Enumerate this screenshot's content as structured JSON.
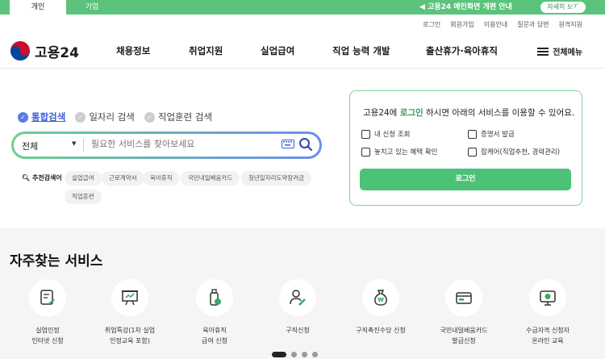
{
  "topbar": {
    "tabs": [
      "개인",
      "기업"
    ],
    "notice": "고용24 메인화면 개편 안내",
    "notice_button": "자세히 보기",
    "pause_icon": "pause-icon"
  },
  "util_links": [
    "로그인",
    "회원가입",
    "이용안내",
    "질문과 답변",
    "원격지원"
  ],
  "logo": {
    "text": "고용24"
  },
  "gnb": [
    "채용정보",
    "취업지원",
    "실업급여",
    "직업 능력 개발",
    "출산휴가·육아휴직"
  ],
  "menu_all": "전체메뉴",
  "search": {
    "tabs": [
      "통합검색",
      "일자리 검색",
      "직업훈련 검색"
    ],
    "select_value": "전체",
    "placeholder": "필요한 서비스를 찾아보세요",
    "reco_label": "추천검색어",
    "chips": [
      "실업급여",
      "근로계약서",
      "육아휴직",
      "국민내일배움카드",
      "청년일자리도약장려금",
      "직업훈련"
    ]
  },
  "login_box": {
    "title_pre": "고용24에 ",
    "title_link": "로그인",
    "title_post": " 하시면 아래의 서비스를 이용할 수 있어요.",
    "services": [
      "내 신청 조회",
      "증명서 발급",
      "놓치고 있는 혜택 확인",
      "잡케어(직업추천, 경력관리)"
    ],
    "button": "로그인"
  },
  "frequent": {
    "title": "자주찾는 서비스",
    "items": [
      {
        "label": "실업인정\n인터넷 신청",
        "icon": "document-pen-icon"
      },
      {
        "label": "취업특강(1차 실업\n인정교육 포함)",
        "icon": "lecture-board-icon"
      },
      {
        "label": "육아휴직\n급여 신청",
        "icon": "baby-bottle-icon"
      },
      {
        "label": "구직신청",
        "icon": "person-pen-icon"
      },
      {
        "label": "구직촉진수당 신청",
        "icon": "money-bag-icon"
      },
      {
        "label": "국민내일배움카드\n발급신청",
        "icon": "card-icon"
      },
      {
        "label": "수급자격 신청자\n온라인 교육",
        "icon": "monitor-play-icon"
      }
    ]
  },
  "colors": {
    "brand_green": "#4cc277",
    "accent_blue": "#3a5fd9"
  }
}
